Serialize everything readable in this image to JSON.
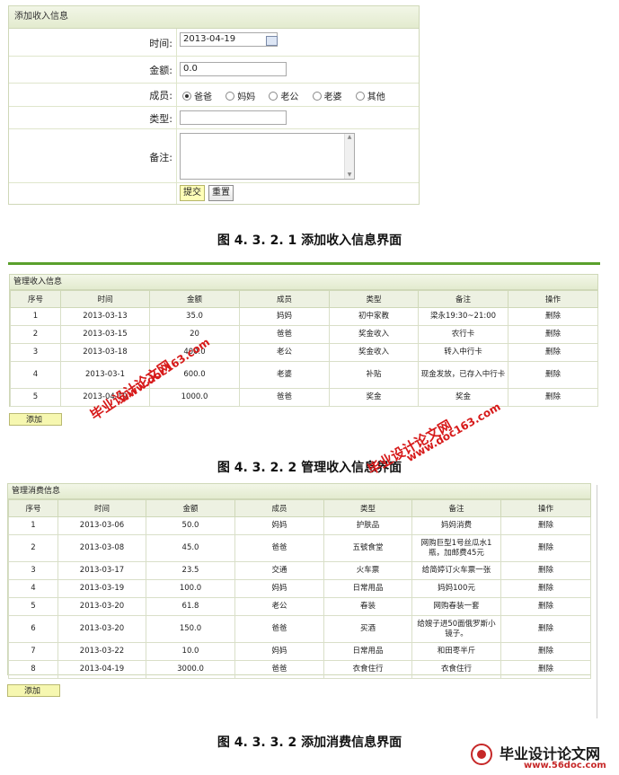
{
  "form": {
    "title": "添加收入信息",
    "time_label": "时间:",
    "time_value": "2013-04-19",
    "amount_label": "金额:",
    "amount_value": "0.0",
    "member_label": "成员:",
    "members": [
      "爸爸",
      "妈妈",
      "老公",
      "老婆",
      "其他"
    ],
    "selected_member": "爸爸",
    "type_label": "类型:",
    "type_value": "",
    "note_label": "备注:",
    "submit": "提交",
    "reset": "重置"
  },
  "captions": {
    "fig1": "图 4. 3. 2. 1 添加收入信息界面",
    "fig2": "图 4. 3. 2. 2 管理收入信息界面",
    "fig3": "图 4. 3. 3. 2 添加消费信息界面"
  },
  "income_table": {
    "title": "管理收入信息",
    "headers": [
      "序号",
      "时间",
      "金额",
      "成员",
      "类型",
      "备注",
      "操作"
    ],
    "rows": [
      [
        "1",
        "2013-03-13",
        "35.0",
        "妈妈",
        "初中家教",
        "梁永19:30~21:00",
        "删除"
      ],
      [
        "2",
        "2013-03-15",
        "20",
        "爸爸",
        "奖金收入",
        "农行卡",
        "删除"
      ],
      [
        "3",
        "2013-03-18",
        "400.0",
        "老公",
        "奖金收入",
        "转入中行卡",
        "删除"
      ],
      [
        "4",
        "2013-03-1",
        "600.0",
        "老婆",
        "补贴",
        "现金发放，已存入中行卡",
        "删除"
      ],
      [
        "5",
        "2013-04-19",
        "1000.0",
        "爸爸",
        "奖金",
        "奖金",
        "删除"
      ]
    ],
    "add": "添加"
  },
  "expense_table": {
    "title": "管理消费信息",
    "headers": [
      "序号",
      "时间",
      "金额",
      "成员",
      "类型",
      "备注",
      "操作"
    ],
    "rows": [
      [
        "1",
        "2013-03-06",
        "50.0",
        "妈妈",
        "护肤品",
        "妈妈消费",
        "删除"
      ],
      [
        "2",
        "2013-03-08",
        "45.0",
        "爸爸",
        "五號食堂",
        "网购巨型1号丝瓜水1瓶，加邮费45元",
        "删除"
      ],
      [
        "3",
        "2013-03-17",
        "23.5",
        "交通",
        "火车票",
        "给简婷订火车票一张",
        "删除"
      ],
      [
        "4",
        "2013-03-19",
        "100.0",
        "妈妈",
        "日常用品",
        "妈妈100元",
        "删除"
      ],
      [
        "5",
        "2013-03-20",
        "61.8",
        "老公",
        "春装",
        "网购春装一套",
        "删除"
      ],
      [
        "6",
        "2013-03-20",
        "150.0",
        "爸爸",
        "买酒",
        "给嫂子进50面俄罗斯小镜子。",
        "删除"
      ],
      [
        "7",
        "2013-03-22",
        "10.0",
        "妈妈",
        "日常用品",
        "和田枣半斤",
        "删除"
      ],
      [
        "8",
        "2013-04-19",
        "3000.0",
        "爸爸",
        "衣食住行",
        "衣食住行",
        "删除"
      ]
    ],
    "add": "添加"
  },
  "watermarks": {
    "cn": "毕业设计论文网",
    "url": "www.doc163.com"
  },
  "footer_logo": {
    "cn": "毕业设计论文网",
    "url": "www.56doc.com"
  }
}
